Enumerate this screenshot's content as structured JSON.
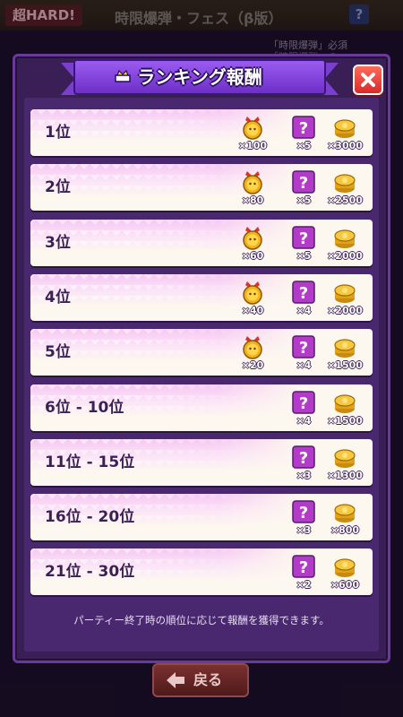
{
  "background": {
    "difficulty": "超HARD!",
    "event_title": "時限爆弾・フェス（β版）",
    "help": "?",
    "note_line1": "「時限爆弾」必須",
    "note_line2": "「時限爆弾」の..."
  },
  "modal": {
    "title": "ランキング報酬",
    "title_icon": "trophy-icon",
    "close_icon": "close-icon"
  },
  "rows": [
    {
      "rank": "1位",
      "medal": "×100",
      "ticket": "×5",
      "coin": "×3000"
    },
    {
      "rank": "2位",
      "medal": "×80",
      "ticket": "×5",
      "coin": "×2500"
    },
    {
      "rank": "3位",
      "medal": "×60",
      "ticket": "×5",
      "coin": "×2000"
    },
    {
      "rank": "4位",
      "medal": "×40",
      "ticket": "×4",
      "coin": "×2000"
    },
    {
      "rank": "5位",
      "medal": "×20",
      "ticket": "×4",
      "coin": "×1500"
    },
    {
      "rank": "6位 - 10位",
      "ticket": "×4",
      "coin": "×1500"
    },
    {
      "rank": "11位 - 15位",
      "ticket": "×3",
      "coin": "×1300"
    },
    {
      "rank": "16位 - 20位",
      "ticket": "×3",
      "coin": "×800"
    },
    {
      "rank": "21位 - 30位",
      "ticket": "×2",
      "coin": "×600"
    }
  ],
  "footer_note": "パーティー終了時の順位に応じて報酬を獲得できます。",
  "back_button": "戻る",
  "colors": {
    "modal_bg": "#3a1f57",
    "banner": "#7b3fd0",
    "close": "#d92a2a",
    "row_pink": "#f6c8f2",
    "row_cream": "#fdf8ef"
  }
}
